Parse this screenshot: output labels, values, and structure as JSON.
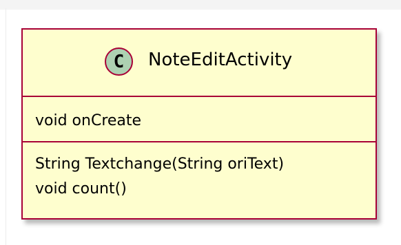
{
  "class": {
    "stereotype_letter": "C",
    "name": "NoteEditActivity",
    "fields": [
      "void onCreate"
    ],
    "methods": [
      "String Textchange(String oriText)",
      "void count()"
    ]
  },
  "colors": {
    "box_fill": "#fefece",
    "box_border": "#a80036",
    "stereotype_circle_fill": "#add1b2"
  }
}
